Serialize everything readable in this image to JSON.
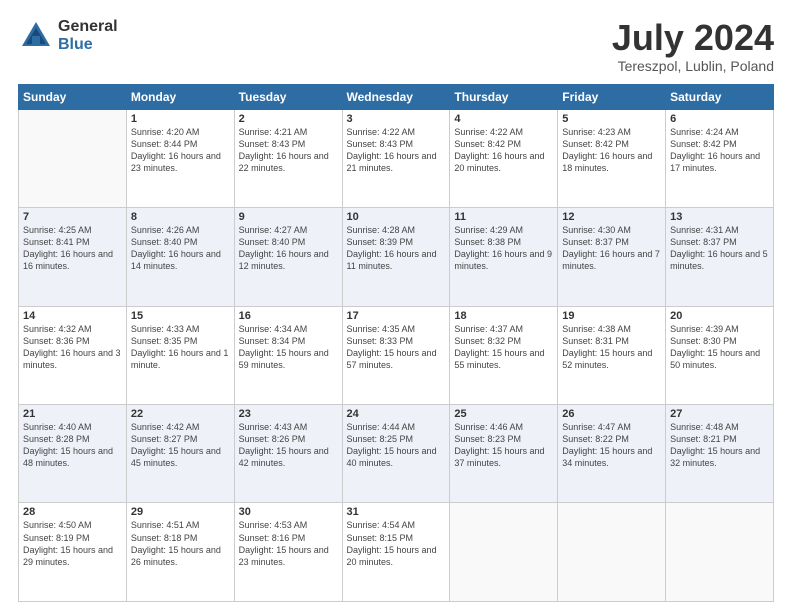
{
  "header": {
    "logo_general": "General",
    "logo_blue": "Blue",
    "month_title": "July 2024",
    "location": "Tereszpol, Lublin, Poland"
  },
  "days_of_week": [
    "Sunday",
    "Monday",
    "Tuesday",
    "Wednesday",
    "Thursday",
    "Friday",
    "Saturday"
  ],
  "weeks": [
    [
      {
        "day": "",
        "sunrise": "",
        "sunset": "",
        "daylight": ""
      },
      {
        "day": "1",
        "sunrise": "Sunrise: 4:20 AM",
        "sunset": "Sunset: 8:44 PM",
        "daylight": "Daylight: 16 hours and 23 minutes."
      },
      {
        "day": "2",
        "sunrise": "Sunrise: 4:21 AM",
        "sunset": "Sunset: 8:43 PM",
        "daylight": "Daylight: 16 hours and 22 minutes."
      },
      {
        "day": "3",
        "sunrise": "Sunrise: 4:22 AM",
        "sunset": "Sunset: 8:43 PM",
        "daylight": "Daylight: 16 hours and 21 minutes."
      },
      {
        "day": "4",
        "sunrise": "Sunrise: 4:22 AM",
        "sunset": "Sunset: 8:42 PM",
        "daylight": "Daylight: 16 hours and 20 minutes."
      },
      {
        "day": "5",
        "sunrise": "Sunrise: 4:23 AM",
        "sunset": "Sunset: 8:42 PM",
        "daylight": "Daylight: 16 hours and 18 minutes."
      },
      {
        "day": "6",
        "sunrise": "Sunrise: 4:24 AM",
        "sunset": "Sunset: 8:42 PM",
        "daylight": "Daylight: 16 hours and 17 minutes."
      }
    ],
    [
      {
        "day": "7",
        "sunrise": "Sunrise: 4:25 AM",
        "sunset": "Sunset: 8:41 PM",
        "daylight": "Daylight: 16 hours and 16 minutes."
      },
      {
        "day": "8",
        "sunrise": "Sunrise: 4:26 AM",
        "sunset": "Sunset: 8:40 PM",
        "daylight": "Daylight: 16 hours and 14 minutes."
      },
      {
        "day": "9",
        "sunrise": "Sunrise: 4:27 AM",
        "sunset": "Sunset: 8:40 PM",
        "daylight": "Daylight: 16 hours and 12 minutes."
      },
      {
        "day": "10",
        "sunrise": "Sunrise: 4:28 AM",
        "sunset": "Sunset: 8:39 PM",
        "daylight": "Daylight: 16 hours and 11 minutes."
      },
      {
        "day": "11",
        "sunrise": "Sunrise: 4:29 AM",
        "sunset": "Sunset: 8:38 PM",
        "daylight": "Daylight: 16 hours and 9 minutes."
      },
      {
        "day": "12",
        "sunrise": "Sunrise: 4:30 AM",
        "sunset": "Sunset: 8:37 PM",
        "daylight": "Daylight: 16 hours and 7 minutes."
      },
      {
        "day": "13",
        "sunrise": "Sunrise: 4:31 AM",
        "sunset": "Sunset: 8:37 PM",
        "daylight": "Daylight: 16 hours and 5 minutes."
      }
    ],
    [
      {
        "day": "14",
        "sunrise": "Sunrise: 4:32 AM",
        "sunset": "Sunset: 8:36 PM",
        "daylight": "Daylight: 16 hours and 3 minutes."
      },
      {
        "day": "15",
        "sunrise": "Sunrise: 4:33 AM",
        "sunset": "Sunset: 8:35 PM",
        "daylight": "Daylight: 16 hours and 1 minute."
      },
      {
        "day": "16",
        "sunrise": "Sunrise: 4:34 AM",
        "sunset": "Sunset: 8:34 PM",
        "daylight": "Daylight: 15 hours and 59 minutes."
      },
      {
        "day": "17",
        "sunrise": "Sunrise: 4:35 AM",
        "sunset": "Sunset: 8:33 PM",
        "daylight": "Daylight: 15 hours and 57 minutes."
      },
      {
        "day": "18",
        "sunrise": "Sunrise: 4:37 AM",
        "sunset": "Sunset: 8:32 PM",
        "daylight": "Daylight: 15 hours and 55 minutes."
      },
      {
        "day": "19",
        "sunrise": "Sunrise: 4:38 AM",
        "sunset": "Sunset: 8:31 PM",
        "daylight": "Daylight: 15 hours and 52 minutes."
      },
      {
        "day": "20",
        "sunrise": "Sunrise: 4:39 AM",
        "sunset": "Sunset: 8:30 PM",
        "daylight": "Daylight: 15 hours and 50 minutes."
      }
    ],
    [
      {
        "day": "21",
        "sunrise": "Sunrise: 4:40 AM",
        "sunset": "Sunset: 8:28 PM",
        "daylight": "Daylight: 15 hours and 48 minutes."
      },
      {
        "day": "22",
        "sunrise": "Sunrise: 4:42 AM",
        "sunset": "Sunset: 8:27 PM",
        "daylight": "Daylight: 15 hours and 45 minutes."
      },
      {
        "day": "23",
        "sunrise": "Sunrise: 4:43 AM",
        "sunset": "Sunset: 8:26 PM",
        "daylight": "Daylight: 15 hours and 42 minutes."
      },
      {
        "day": "24",
        "sunrise": "Sunrise: 4:44 AM",
        "sunset": "Sunset: 8:25 PM",
        "daylight": "Daylight: 15 hours and 40 minutes."
      },
      {
        "day": "25",
        "sunrise": "Sunrise: 4:46 AM",
        "sunset": "Sunset: 8:23 PM",
        "daylight": "Daylight: 15 hours and 37 minutes."
      },
      {
        "day": "26",
        "sunrise": "Sunrise: 4:47 AM",
        "sunset": "Sunset: 8:22 PM",
        "daylight": "Daylight: 15 hours and 34 minutes."
      },
      {
        "day": "27",
        "sunrise": "Sunrise: 4:48 AM",
        "sunset": "Sunset: 8:21 PM",
        "daylight": "Daylight: 15 hours and 32 minutes."
      }
    ],
    [
      {
        "day": "28",
        "sunrise": "Sunrise: 4:50 AM",
        "sunset": "Sunset: 8:19 PM",
        "daylight": "Daylight: 15 hours and 29 minutes."
      },
      {
        "day": "29",
        "sunrise": "Sunrise: 4:51 AM",
        "sunset": "Sunset: 8:18 PM",
        "daylight": "Daylight: 15 hours and 26 minutes."
      },
      {
        "day": "30",
        "sunrise": "Sunrise: 4:53 AM",
        "sunset": "Sunset: 8:16 PM",
        "daylight": "Daylight: 15 hours and 23 minutes."
      },
      {
        "day": "31",
        "sunrise": "Sunrise: 4:54 AM",
        "sunset": "Sunset: 8:15 PM",
        "daylight": "Daylight: 15 hours and 20 minutes."
      },
      {
        "day": "",
        "sunrise": "",
        "sunset": "",
        "daylight": ""
      },
      {
        "day": "",
        "sunrise": "",
        "sunset": "",
        "daylight": ""
      },
      {
        "day": "",
        "sunrise": "",
        "sunset": "",
        "daylight": ""
      }
    ]
  ]
}
